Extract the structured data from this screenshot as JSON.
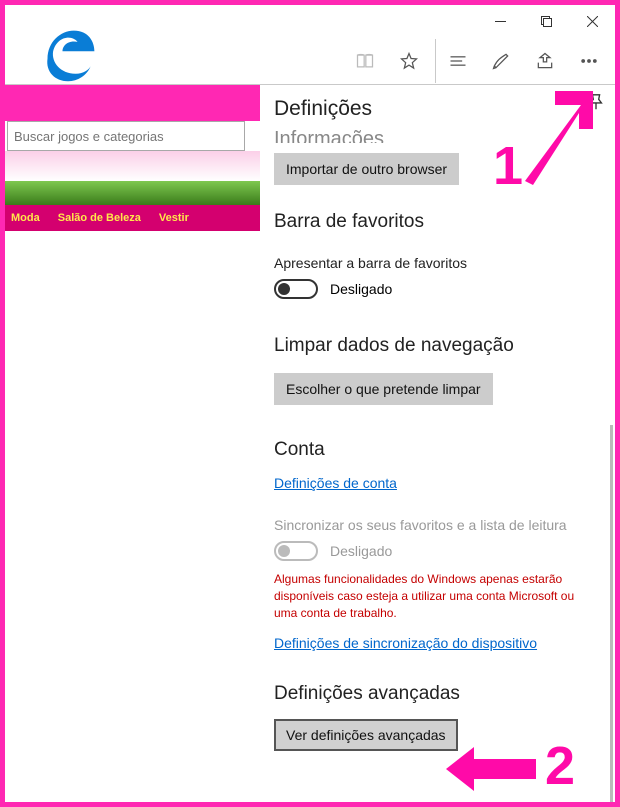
{
  "page": {
    "search_placeholder": "Buscar jogos e categorias",
    "nav": [
      "Moda",
      "Salão de Beleza",
      "Vestir"
    ]
  },
  "settings": {
    "title": "Definições",
    "truncated_heading": "Informações",
    "import_btn": "Importar de outro browser",
    "favbar_h": "Barra de favoritos",
    "favbar_label": "Apresentar a barra de favoritos",
    "favbar_state": "Desligado",
    "clear_h": "Limpar dados de navegação",
    "clear_btn": "Escolher o que pretende limpar",
    "account_h": "Conta",
    "account_link": "Definições de conta",
    "sync_label": "Sincronizar os seus favoritos e a lista de leitura",
    "sync_state": "Desligado",
    "sync_warning": "Algumas funcionalidades do Windows apenas estarão disponíveis caso esteja a utilizar uma conta Microsoft ou uma conta de trabalho.",
    "sync_link": "Definições de sincronização do dispositivo",
    "advanced_h": "Definições avançadas",
    "advanced_btn": "Ver definições avançadas"
  },
  "annotations": {
    "one": "1",
    "two": "2"
  }
}
